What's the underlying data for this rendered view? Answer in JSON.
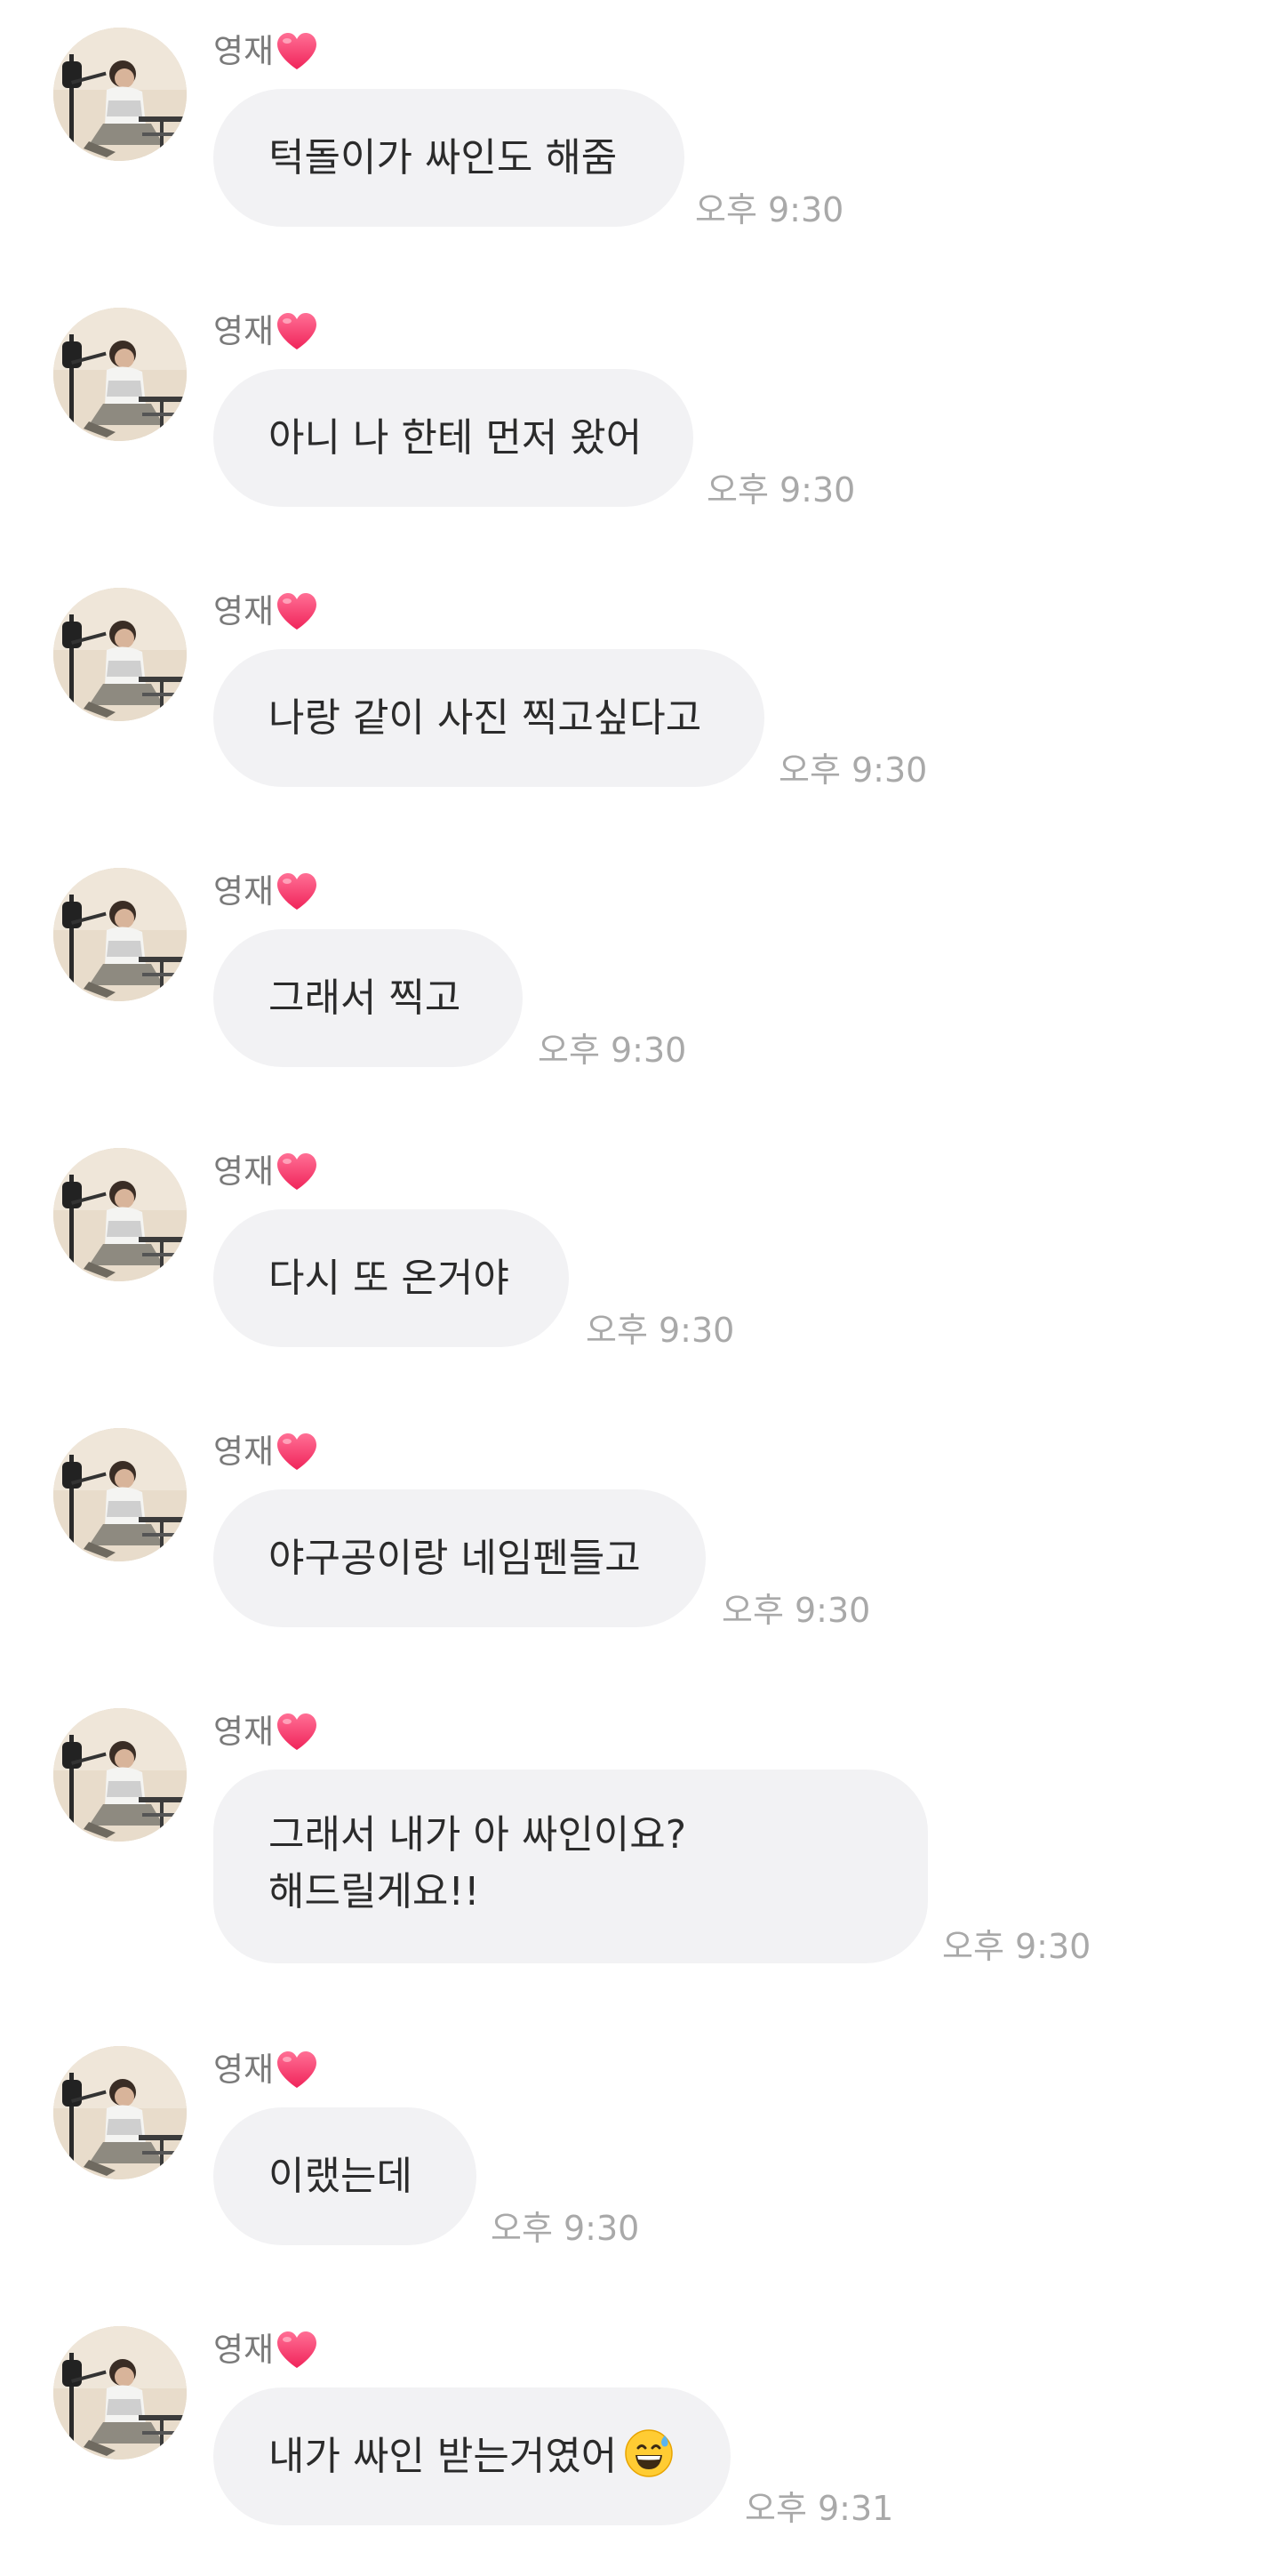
{
  "sender_name": "영재",
  "messages": [
    {
      "text": "턱돌이가 싸인도 해줌",
      "time": "오후 9:30"
    },
    {
      "text": "아니 나 한테 먼저 왔어",
      "time": "오후 9:30"
    },
    {
      "text": "나랑 같이 사진 찍고싶다고",
      "time": "오후 9:30"
    },
    {
      "text": "그래서 찍고",
      "time": "오후 9:30"
    },
    {
      "text": "다시 또 온거야",
      "time": "오후 9:30"
    },
    {
      "text": "야구공이랑 네임펜들고",
      "time": "오후 9:30"
    },
    {
      "text": "그래서 내가 아 싸인이요?\n해드릴게요!!",
      "time": "오후 9:30"
    },
    {
      "text": "이랬는데",
      "time": "오후 9:30"
    },
    {
      "text": "내가 싸인 받는거였어",
      "emoji": "grinning-sweat-emoji",
      "time": "오후 9:31"
    }
  ],
  "colors": {
    "bubble": "#f2f2f4",
    "heart": "#ff3d6e",
    "timestamp": "#a9a9a9",
    "sender": "#7a7a7a"
  }
}
